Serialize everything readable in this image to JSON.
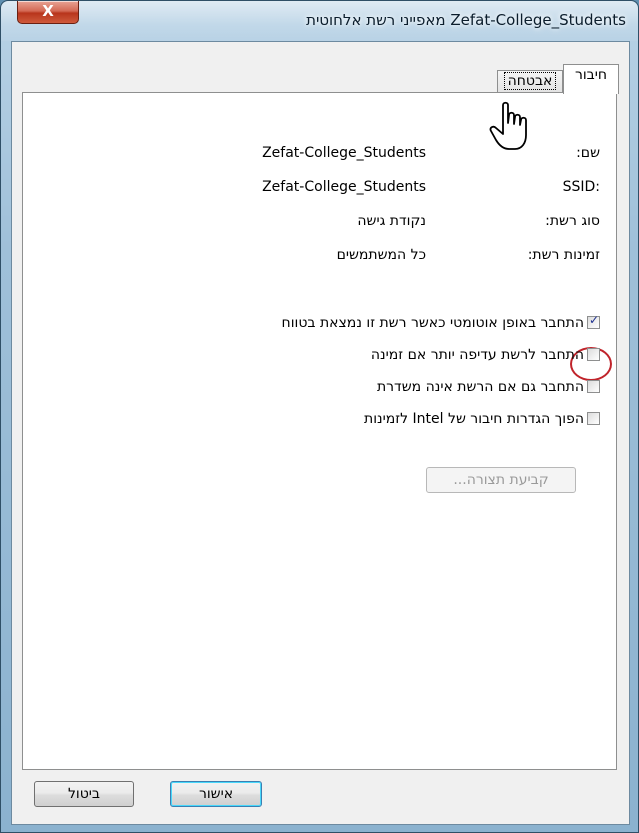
{
  "window": {
    "title": "Zefat-College_Students מאפייני רשת אלחוטית",
    "close_label": "X"
  },
  "tabs": [
    {
      "label": "חיבור",
      "active": true
    },
    {
      "label": "אבטחה",
      "active": false
    }
  ],
  "info": {
    "name_label": "שם:",
    "name_value": "Zefat-College_Students",
    "ssid_label": ":SSID",
    "ssid_value": "Zefat-College_Students",
    "type_label": "סוג רשת:",
    "type_value": "נקודת גישה",
    "avail_label": "זמינות רשת:",
    "avail_value": "כל המשתמשים"
  },
  "options": [
    {
      "label": "התחבר באופן אוטומטי כאשר רשת זו נמצאת בטווח",
      "checked": true
    },
    {
      "label": "התחבר לרשת עדיפה יותר אם זמינה",
      "checked": false
    },
    {
      "label": "התחבר גם אם הרשת אינה משדרת",
      "checked": false
    },
    {
      "label": "הפוך הגדרות חיבור של Intel לזמינות",
      "checked": false
    }
  ],
  "config_button": "קביעת תצורה...",
  "buttons": {
    "ok": "אישור",
    "cancel": "ביטול"
  },
  "colors": {
    "highlight_circle": "#c0242b",
    "check_color": "#1d2f8f"
  },
  "icons": {
    "cursor": "hand-pointer-icon"
  }
}
